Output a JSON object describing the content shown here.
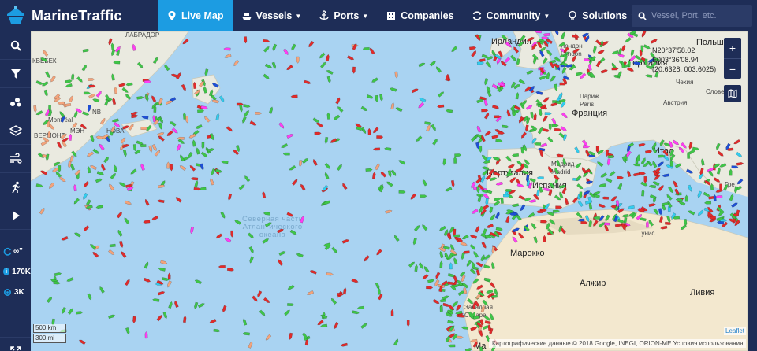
{
  "brand": {
    "name": "MarineTraffic"
  },
  "nav": [
    {
      "label": "Live Map",
      "icon": "map-icon",
      "active": true,
      "caret": ""
    },
    {
      "label": "Vessels",
      "icon": "vessel-icon",
      "active": false,
      "caret": "▼"
    },
    {
      "label": "Ports",
      "icon": "anchor-icon",
      "active": false,
      "caret": "▼"
    },
    {
      "label": "Companies",
      "icon": "building-icon",
      "active": false,
      "caret": ""
    },
    {
      "label": "Community",
      "icon": "sync-icon",
      "active": false,
      "caret": "▼"
    },
    {
      "label": "Solutions",
      "icon": "lightbulb-icon",
      "active": false,
      "caret": "▼"
    }
  ],
  "search": {
    "placeholder": "Vessel, Port, etc."
  },
  "sidebar": {
    "stats": [
      {
        "icon": "infinity-icon",
        "value": "∞\""
      },
      {
        "icon": "info-icon",
        "value": "170K"
      },
      {
        "icon": "position-icon",
        "value": "3K"
      }
    ]
  },
  "map": {
    "coords": {
      "lat": "N20°37'58.02",
      "lon": "E003°36'08.94",
      "xy": "(20.6328, 003.6025)"
    },
    "labels": {
      "labrador": "ЛАБРАДОР",
      "quebec": "КВЕБЕК",
      "montreal": "Montréal",
      "vermont": "ВЕРМОНТ",
      "nova": "НОВА",
      "meh": "МЭН",
      "nb": "NB",
      "ireland": "Ирландия",
      "london": "Лондон\nLondon",
      "germany": "Германия",
      "poland": "Польша",
      "czech": "Чехия",
      "austria": "Австрия",
      "slovenia": "Слове",
      "paris": "Париж\nParis",
      "france": "Франция",
      "italy": "Итал",
      "madrid": "Мадрид\nMadrid",
      "portugal": "Португалия",
      "spain": "Испания",
      "tunisia": "Тунис",
      "morocco": "Марокко",
      "algeria": "Алжир",
      "libya": "Ливия",
      "wsahara": "Западная\nСахара",
      "greece": "Гре",
      "mauritania": "Ма",
      "atlantic": "Северная часть\nАтлантического\nокеана"
    },
    "scale": [
      "500 km",
      "300 mi"
    ],
    "attribution": "Картографические данные © 2018 Google, INEGI, ORION-ME    Условия использования",
    "leaflet": "Leaflet"
  },
  "colors": {
    "nav_bg": "#1e2d57",
    "active": "#1c9ce2",
    "ocean": "#a9d3f2",
    "land": "#eaeae0",
    "desert": "#f3e8cf",
    "cargo": "#3fc548",
    "tanker": "#e02b2b",
    "passenger": "#1f4fd6",
    "special": "#ff3df2",
    "fishing": "#f3a37b",
    "unknown": "#33ccee"
  }
}
